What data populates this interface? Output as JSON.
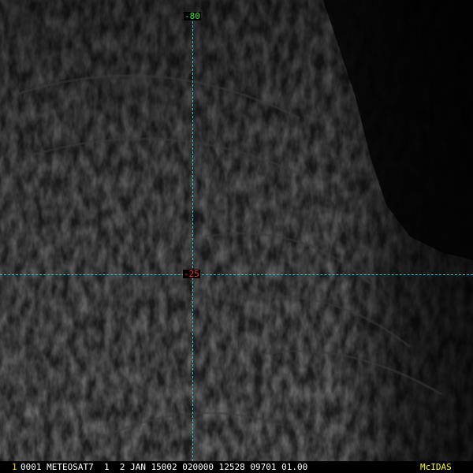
{
  "overlay": {
    "longitude_label": "-80",
    "latitude_label": "-25"
  },
  "statusbar": {
    "frame_number": "1",
    "info": "0001 METEOSAT7  1  2 JAN 15002 020000 12528 09701 01.00",
    "brand": "McIDAS"
  },
  "colors": {
    "longitude_label": "#33ee33",
    "latitude_label": "#ff3030",
    "grid_lines": "#27c7d6",
    "frame_number": "#ffcc00",
    "brand": "#ffff00"
  }
}
